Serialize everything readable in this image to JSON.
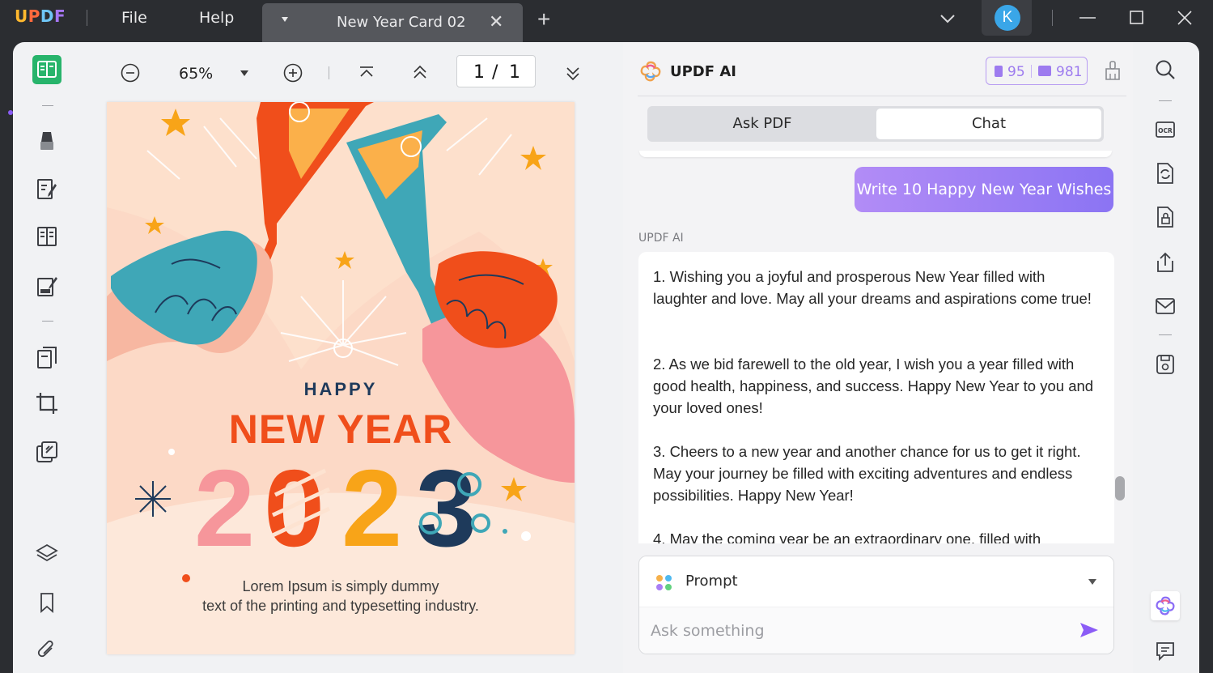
{
  "app": {
    "logo": [
      "U",
      "P",
      "D",
      "F"
    ],
    "menu": {
      "file": "File",
      "help": "Help"
    }
  },
  "tab": {
    "title": "New Year Card 02"
  },
  "user": {
    "avatar_letter": "K"
  },
  "toolbar": {
    "zoom": "65%",
    "page_current": "1",
    "page_sep": "/",
    "page_total": "1"
  },
  "document": {
    "happy": "HAPPY",
    "new_year": "NEW YEAR",
    "year_digits": [
      "2",
      "0",
      "2",
      "3"
    ],
    "lorem_line1": "Lorem Ipsum is simply dummy",
    "lorem_line2": "text of the printing and typesetting industry."
  },
  "ai_panel": {
    "title": "UPDF AI",
    "credits_doc": "95",
    "credits_chat": "981",
    "tabs": [
      {
        "label": "Ask PDF",
        "active": false
      },
      {
        "label": "Chat",
        "active": true
      }
    ],
    "user_message": "Write 10 Happy New Year Wishes",
    "ai_label": "UPDF AI",
    "answer": [
      "1. Wishing you a joyful and prosperous New Year filled with laughter and love. May all your dreams and aspirations come true!",
      "2. As we bid farewell to the old year, I wish you a year filled with good health, happiness, and success. Happy New Year to you and your loved ones!",
      "3. Cheers to a new year and another chance for us to get it right. May your journey be filled with exciting adventures and endless possibilities. Happy New Year!",
      "4. May the coming year be an extraordinary one, filled with"
    ],
    "prompt_label": "Prompt",
    "ask_placeholder": "Ask something"
  },
  "colors": {
    "brand_green": "#27b46b",
    "accent_purple": "#8b74f3",
    "card_orange": "#f04e1b",
    "card_navy": "#1e3a5b"
  },
  "icons": {
    "left_rail": [
      "reader-icon",
      "highlight-icon",
      "edit-text-icon",
      "organize-pages-icon",
      "fill-sign-icon",
      "page-tools-icon",
      "crop-icon",
      "protect-icon",
      "layers-icon",
      "bookmark-icon",
      "attachment-icon"
    ],
    "right_rail": [
      "search-icon",
      "ocr-icon",
      "convert-icon",
      "protect-file-icon",
      "share-icon",
      "email-icon",
      "save-icon",
      "updf-ai-icon",
      "comment-icon"
    ]
  }
}
